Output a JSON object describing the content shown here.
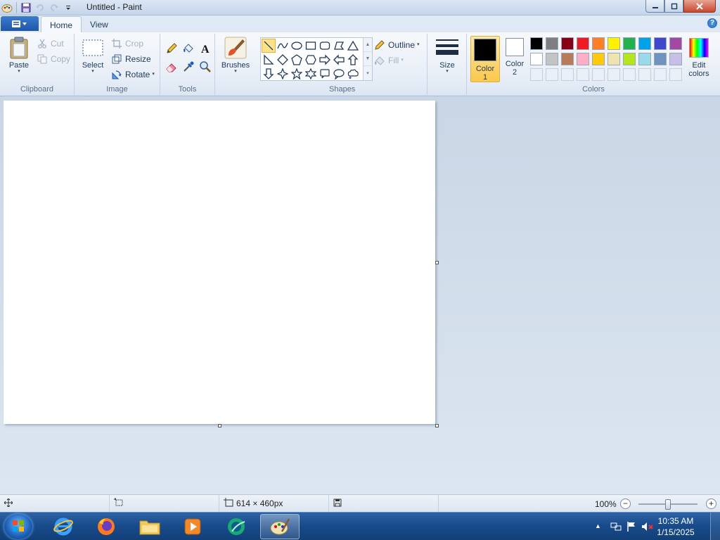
{
  "window": {
    "title": "Untitled - Paint"
  },
  "tabs": [
    {
      "label": "Home"
    },
    {
      "label": "View"
    }
  ],
  "clipboard": {
    "paste": "Paste",
    "cut": "Cut",
    "copy": "Copy",
    "group": "Clipboard"
  },
  "image": {
    "select": "Select",
    "crop": "Crop",
    "resize": "Resize",
    "rotate": "Rotate",
    "group": "Image"
  },
  "tools": {
    "group": "Tools"
  },
  "brushes": {
    "label": "Brushes"
  },
  "shapes": {
    "outline": "Outline",
    "fill": "Fill",
    "group": "Shapes"
  },
  "size": {
    "label": "Size"
  },
  "colors": {
    "color1": {
      "label": "Color",
      "num": "1",
      "value": "#000000"
    },
    "color2": {
      "label": "Color",
      "num": "2",
      "value": "#ffffff"
    },
    "edit": {
      "line1": "Edit",
      "line2": "colors"
    },
    "group": "Colors",
    "palette_row1": [
      "#000000",
      "#7f7f7f",
      "#880015",
      "#ed1c24",
      "#ff7f27",
      "#fff200",
      "#22b14c",
      "#00a2e8",
      "#3f48cc",
      "#a349a4"
    ],
    "palette_row2": [
      "#ffffff",
      "#c3c3c3",
      "#b97a57",
      "#ffaec9",
      "#ffc90e",
      "#efe4b0",
      "#b5e61d",
      "#99d9ea",
      "#7092be",
      "#c8bfe7"
    ]
  },
  "statusbar": {
    "dimensions": "614 × 460px",
    "zoom": "100%"
  },
  "taskbar": {
    "time": "10:35 AM",
    "date": "1/15/2025"
  }
}
